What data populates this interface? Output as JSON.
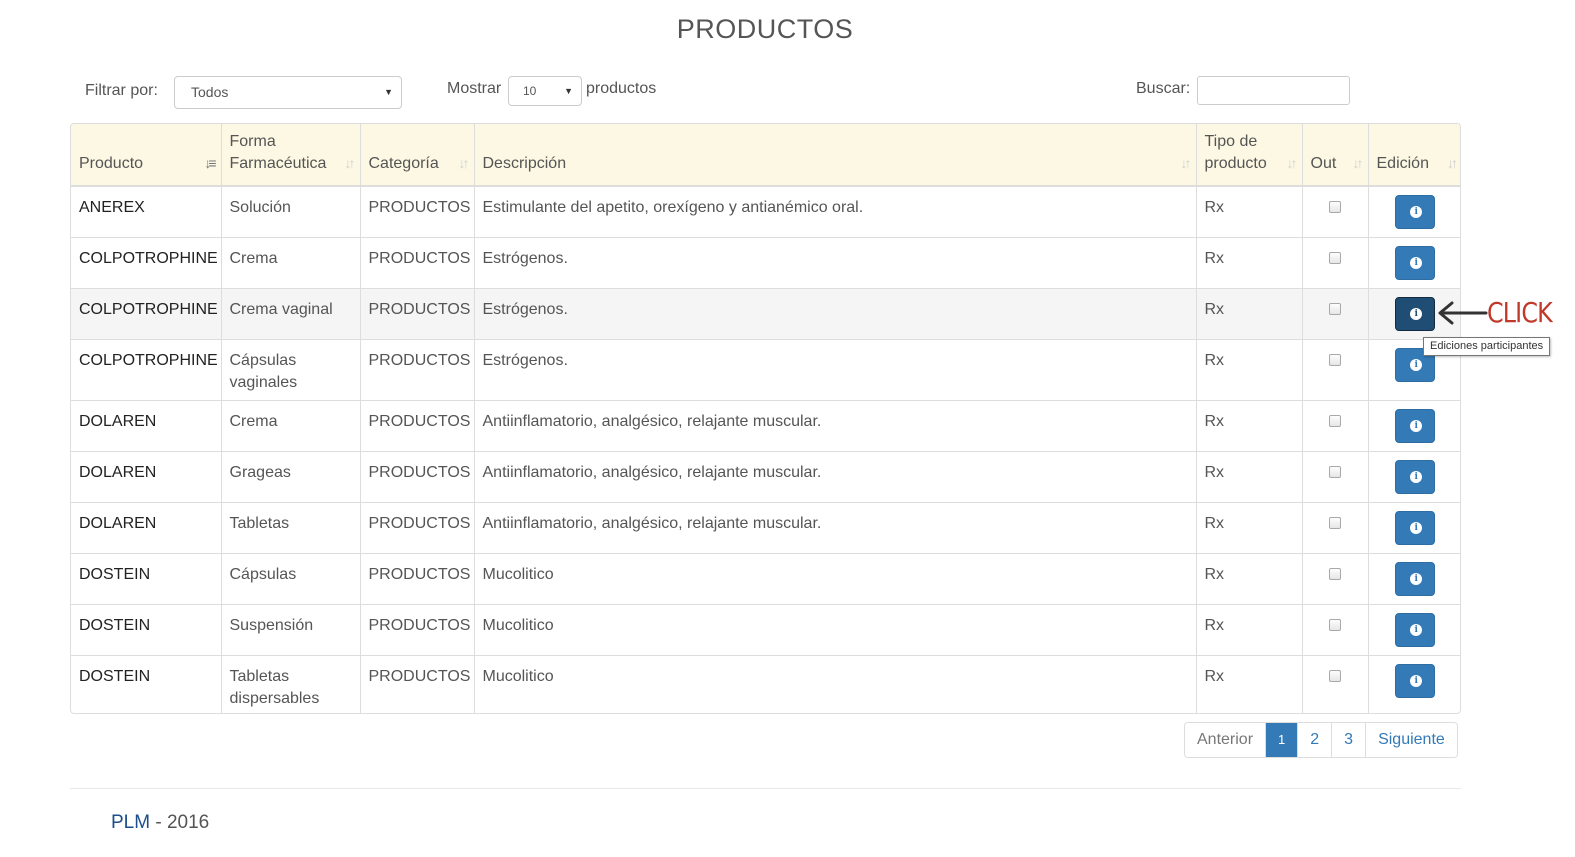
{
  "page_title": "PRODUCTOS",
  "filter": {
    "label": "Filtrar por:",
    "value": "Todos"
  },
  "show": {
    "label": "Mostrar",
    "value": "10",
    "suffix": "productos"
  },
  "search": {
    "label": "Buscar:",
    "value": ""
  },
  "columns": [
    {
      "label": "Producto",
      "sort": "active"
    },
    {
      "label": "Forma Farmacéutica",
      "sort": "none"
    },
    {
      "label": "Categoría",
      "sort": "none"
    },
    {
      "label": "Descripción",
      "sort": "none"
    },
    {
      "label": "Tipo de producto",
      "sort": "none"
    },
    {
      "label": "Out",
      "sort": "none"
    },
    {
      "label": "Edición",
      "sort": "none"
    }
  ],
  "rows": [
    {
      "producto": "ANEREX",
      "forma": "Solución",
      "categoria": "PRODUCTOS",
      "descripcion": "Estimulante del apetito, orexígeno y antianémico oral.",
      "tipo": "Rx",
      "out": false
    },
    {
      "producto": "COLPOTROPHINE",
      "forma": "Crema",
      "categoria": "PRODUCTOS",
      "descripcion": "Estrógenos.",
      "tipo": "Rx",
      "out": false
    },
    {
      "producto": "COLPOTROPHINE",
      "forma": "Crema vaginal",
      "categoria": "PRODUCTOS",
      "descripcion": "Estrógenos.",
      "tipo": "Rx",
      "out": false
    },
    {
      "producto": "COLPOTROPHINE",
      "forma": "Cápsulas vaginales",
      "categoria": "PRODUCTOS",
      "descripcion": "Estrógenos.",
      "tipo": "Rx",
      "out": false
    },
    {
      "producto": "DOLAREN",
      "forma": "Crema",
      "categoria": "PRODUCTOS",
      "descripcion": "Antiinflamatorio, analgésico, relajante muscular.",
      "tipo": "Rx",
      "out": false
    },
    {
      "producto": "DOLAREN",
      "forma": "Grageas",
      "categoria": "PRODUCTOS",
      "descripcion": "Antiinflamatorio, analgésico, relajante muscular.",
      "tipo": "Rx",
      "out": false
    },
    {
      "producto": "DOLAREN",
      "forma": "Tabletas",
      "categoria": "PRODUCTOS",
      "descripcion": "Antiinflamatorio, analgésico, relajante muscular.",
      "tipo": "Rx",
      "out": false
    },
    {
      "producto": "DOSTEIN",
      "forma": "Cápsulas",
      "categoria": "PRODUCTOS",
      "descripcion": "Mucolitico",
      "tipo": "Rx",
      "out": false
    },
    {
      "producto": "DOSTEIN",
      "forma": "Suspensión",
      "categoria": "PRODUCTOS",
      "descripcion": "Mucolitico",
      "tipo": "Rx",
      "out": false
    },
    {
      "producto": "DOSTEIN",
      "forma": "Tabletas dispersables",
      "categoria": "PRODUCTOS",
      "descripcion": "Mucolitico",
      "tipo": "Rx",
      "out": false
    }
  ],
  "edit_button": {
    "icon": "info-circle-icon",
    "color": "#337ab7",
    "pressed_color": "#204d74"
  },
  "tooltip": "Ediciones participantes",
  "annotation": "CLICK",
  "pagination": {
    "prev": "Anterior",
    "pages": [
      "1",
      "2",
      "3"
    ],
    "active": "1",
    "next": "Siguiente"
  },
  "footer": {
    "brand": "PLM",
    "separator": "-",
    "year": "2016"
  },
  "colors": {
    "header_bg": "#fcf8e3",
    "accent": "#337ab7",
    "annotation": "#c0392b"
  }
}
